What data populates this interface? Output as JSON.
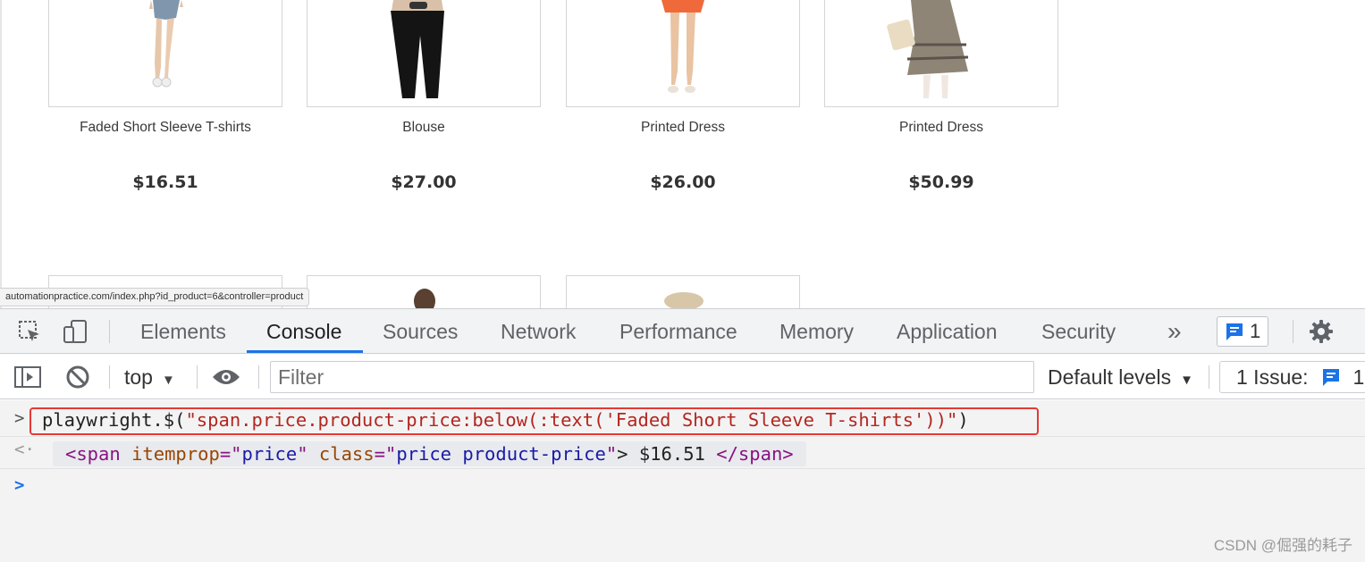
{
  "products": [
    {
      "name": "Faded Short Sleeve T-shirts",
      "price": "$16.51"
    },
    {
      "name": "Blouse",
      "price": "$27.00"
    },
    {
      "name": "Printed Dress",
      "price": "$26.00"
    },
    {
      "name": "Printed Dress",
      "price": "$50.99"
    }
  ],
  "status_url": "automationpractice.com/index.php?id_product=6&controller=product",
  "devtools": {
    "tabs": [
      "Elements",
      "Console",
      "Sources",
      "Network",
      "Performance",
      "Memory",
      "Application",
      "Security"
    ],
    "active_tab": "Console",
    "overflow_label": "»",
    "messages_badge": "1",
    "context": "top",
    "filter_placeholder": "Filter",
    "levels_label": "Default levels",
    "issues_label": "1 Issue:",
    "issues_count": "1"
  },
  "console": {
    "command_prefix": "playwright.$(",
    "command_string": "\"span.price.product-price:below(:text('Faded Short Sleeve T-shirts'))\"",
    "command_suffix": ")",
    "result": {
      "tag_open": "<span",
      "attr1_name": "itemprop",
      "attr1_value": "price",
      "attr2_name": "class",
      "attr2_value": "price product-price",
      "content": "> $16.51 ",
      "tag_close": "</span>"
    }
  },
  "watermark": "CSDN @倔强的耗子",
  "colors": {
    "accent": "#1a73e8",
    "highlight_border": "#e53935"
  }
}
